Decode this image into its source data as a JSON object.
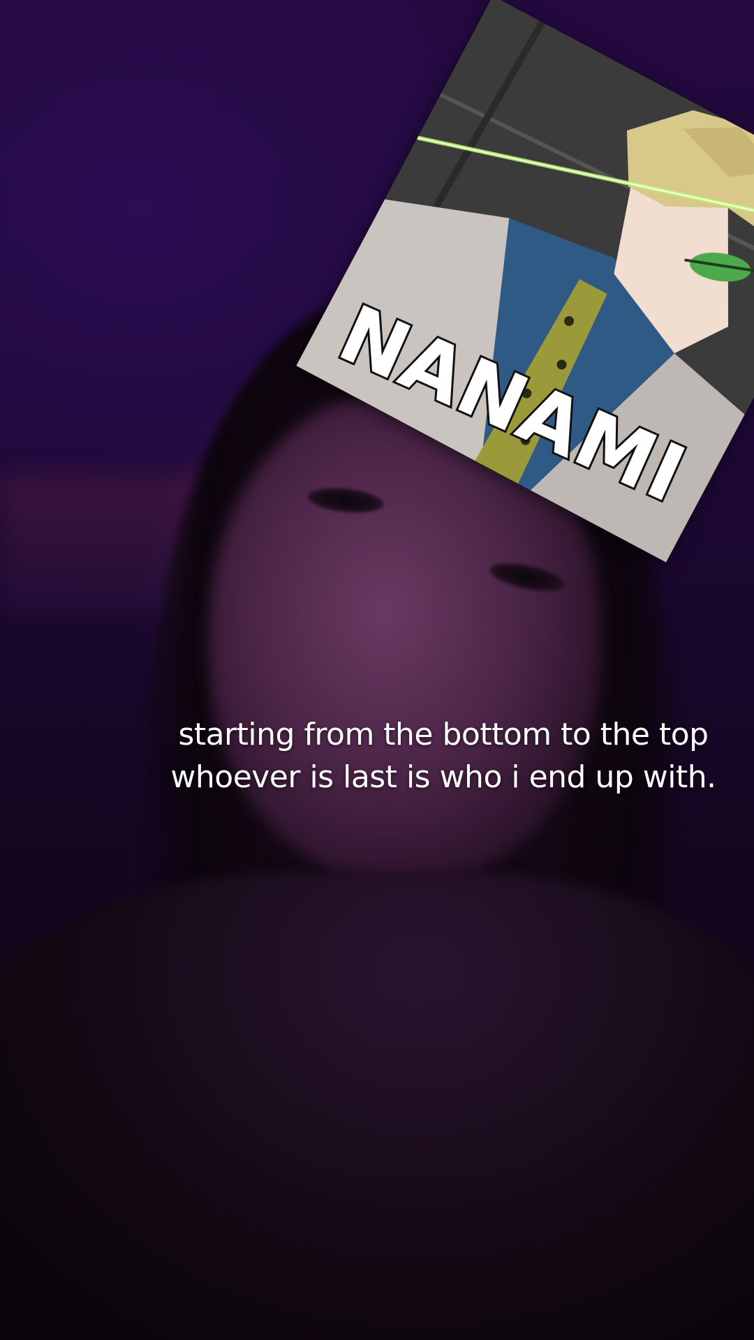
{
  "caption": {
    "text": "starting from the bottom to the top whoever is last is who i end up with."
  },
  "sticker": {
    "label": "NANAMI",
    "image_subject": "anime-character-portrait"
  },
  "colors": {
    "background_purple": "#24093f",
    "caption_text": "#ffffff",
    "sticker_label_fill": "#ffffff",
    "sticker_label_outline": "#111111"
  }
}
